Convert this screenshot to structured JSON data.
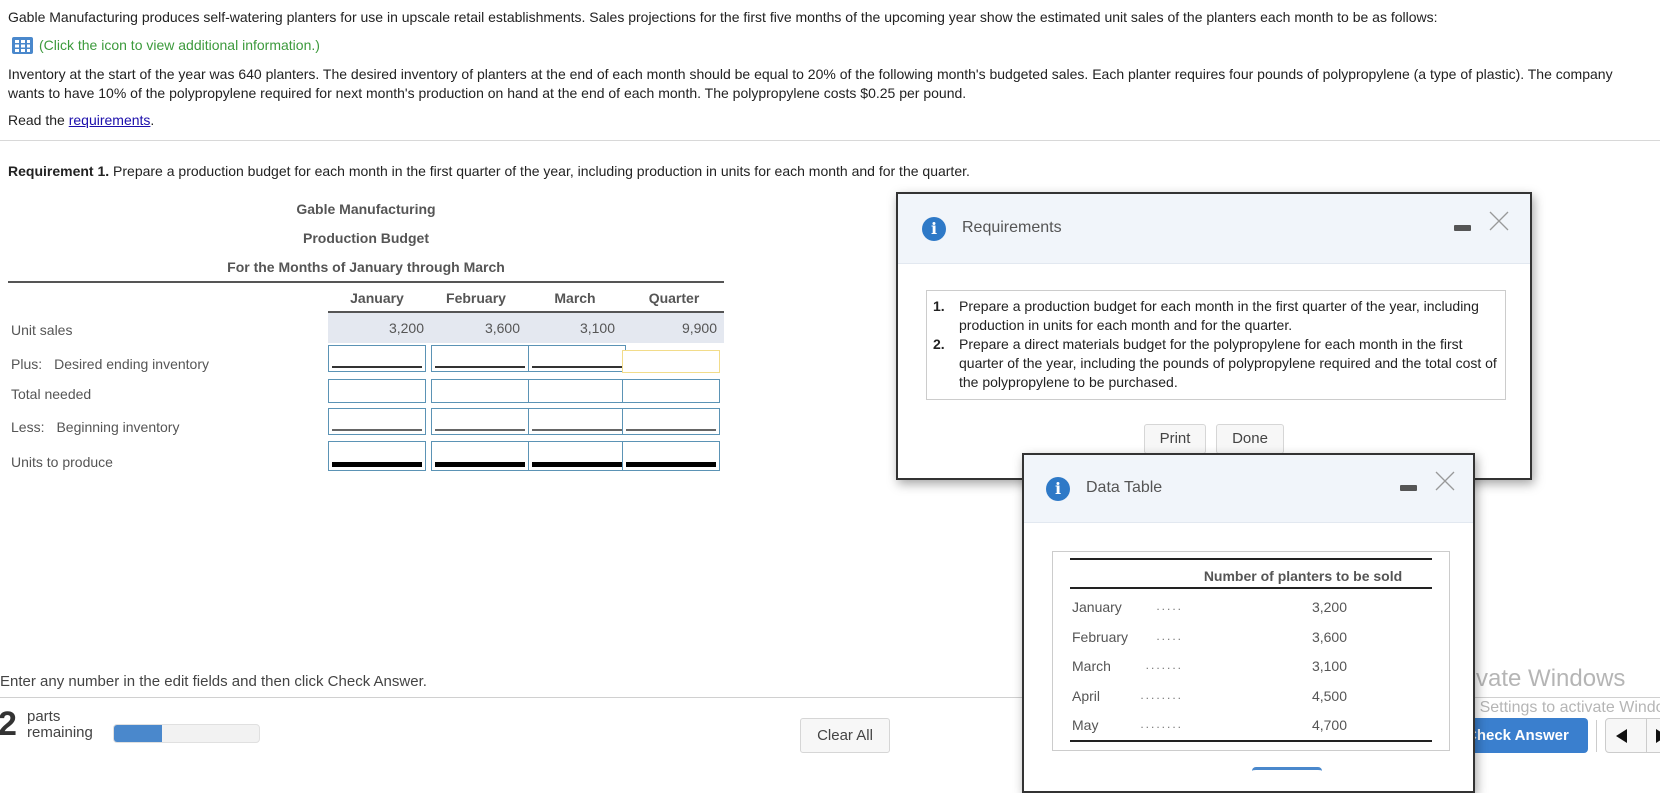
{
  "intro": {
    "paragraph1": "Gable Manufacturing produces self-watering planters for use in upscale retail establishments. Sales projections for the first five months of the upcoming year show the estimated unit sales of the planters each month to be as follows:",
    "info_link": "(Click the icon to view additional information.)",
    "paragraph2": "Inventory at the start of the year was 640 planters. The desired inventory of planters at the end of each month should be equal to 20% of the following month's budgeted sales. Each planter requires four pounds of polypropylene (a type of plastic). The company wants to have 10% of the polypropylene required for next month's production on hand at the end of each month. The polypropylene costs $0.25 per pound.",
    "read_prefix": "Read the ",
    "read_link": "requirements",
    "read_suffix": "."
  },
  "requirement1": {
    "label": "Requirement 1.",
    "text": " Prepare a production budget for each month in the first quarter of the year, including production in units for each month and for the quarter."
  },
  "budget": {
    "company": "Gable Manufacturing",
    "title": "Production Budget",
    "period": "For the Months of January through March",
    "columns": [
      "January",
      "February",
      "March",
      "Quarter"
    ],
    "rows": [
      {
        "label": "Unit sales",
        "values": [
          "3,200",
          "3,600",
          "3,100",
          "9,900"
        ]
      },
      {
        "prefix": "Plus:",
        "label": "Desired ending inventory",
        "values": [
          "",
          "",
          "",
          ""
        ]
      },
      {
        "label": "Total needed",
        "values": [
          "",
          "",
          "",
          ""
        ]
      },
      {
        "prefix": "Less:",
        "label": "Beginning inventory",
        "values": [
          "",
          "",
          "",
          ""
        ]
      },
      {
        "label": "Units to produce",
        "values": [
          "",
          "",
          "",
          ""
        ]
      }
    ]
  },
  "footer": {
    "instruction": "Enter any number in the edit fields and then click Check Answer.",
    "parts_count": "2",
    "parts_line1": "parts",
    "parts_line2": "remaining",
    "progress_fraction": 0.33,
    "clear_all": "Clear All",
    "check_answer": "Check Answer",
    "prev_icon": "triangle-left",
    "next_icon": "triangle-right"
  },
  "requirements_modal": {
    "title": "Requirements",
    "icon": "info-icon",
    "items": [
      {
        "num": "1.",
        "text": "Prepare a production budget for each month in the first quarter of the year, including production in units for each month and for the quarter."
      },
      {
        "num": "2.",
        "text": "Prepare a direct materials budget for the polypropylene for each month in the first quarter of the year, including the pounds of polypropylene required and the total cost of the polypropylene to be purchased."
      }
    ],
    "print": "Print",
    "done": "Done"
  },
  "data_table_modal": {
    "title": "Data Table",
    "icon": "info-icon",
    "header": "Number of planters to be sold",
    "rows": [
      {
        "month": "January",
        "dots": ".....",
        "value": "3,200"
      },
      {
        "month": "February",
        "dots": ".....",
        "value": "3,600"
      },
      {
        "month": "March",
        "dots": ".......",
        "value": "3,100"
      },
      {
        "month": "April",
        "dots": "........",
        "value": "4,500"
      },
      {
        "month": "May",
        "dots": "........",
        "value": "4,700"
      }
    ]
  },
  "watermark": {
    "line1": "Activate Windows",
    "line2": "Go to Settings to activate Windows."
  }
}
